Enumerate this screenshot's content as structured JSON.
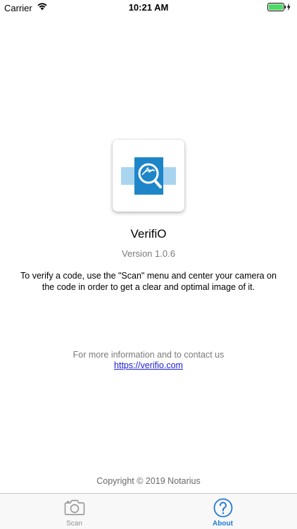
{
  "status_bar": {
    "carrier": "Carrier",
    "time": "10:21 AM",
    "battery_color": "#4cd964",
    "icons": [
      "wifi-icon",
      "battery-icon",
      "charging-bolt-icon"
    ]
  },
  "about": {
    "app_name": "VerifiO",
    "version": "Version 1.0.6",
    "description": "To verify a code, use the \"Scan\" menu and center your camera on the code in order to get a clear and optimal image of it.",
    "contact_text": "For more information and to contact us",
    "contact_link": "https://verifio.com",
    "copyright": "Copyright © 2019 Notarius",
    "icon_colors": {
      "primary": "#1e86c8",
      "light": "#a8d4ef"
    }
  },
  "tab_bar": {
    "tabs": [
      {
        "label": "Scan",
        "icon": "camera-icon",
        "active": false
      },
      {
        "label": "About",
        "icon": "question-icon",
        "active": true
      }
    ],
    "active_color": "#1f7ad6",
    "inactive_color": "#8e8e93"
  }
}
